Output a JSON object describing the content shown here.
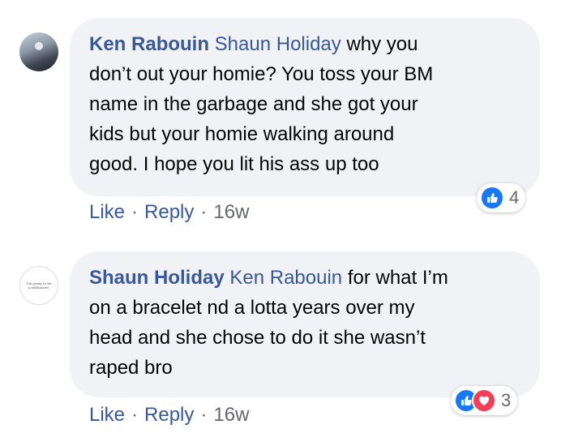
{
  "comments": [
    {
      "author": "Ken Rabouin",
      "mention": "Shaun Holiday",
      "lines": [
        "why you",
        "don’t out your homie? You toss your BM",
        "name in the garbage and she got your",
        "kids but your homie walking around",
        "good. I hope you lit his ass up too"
      ],
      "actions": {
        "like": "Like",
        "reply": "Reply",
        "sep": "·",
        "time": "16w"
      },
      "reactions": {
        "count": "4",
        "icons": [
          "like-icon"
        ]
      }
    },
    {
      "author": "Shaun Holiday",
      "mention": "Ken Rabouin",
      "avatar_text": "I'm going to be a millionaire.",
      "lines": [
        "for what I’m",
        "on a bracelet nd a lotta years over my",
        "head and she chose to do it she wasn’t",
        "raped bro"
      ],
      "actions": {
        "like": "Like",
        "reply": "Reply",
        "sep": "·",
        "time": "16w"
      },
      "reactions": {
        "count": "3",
        "icons": [
          "like-icon",
          "love-icon"
        ]
      }
    }
  ],
  "colors": {
    "link": "#385898",
    "bubble": "#f0f2f5",
    "meta": "#65676b",
    "like": "#1877f2",
    "love": "#f33e58"
  }
}
